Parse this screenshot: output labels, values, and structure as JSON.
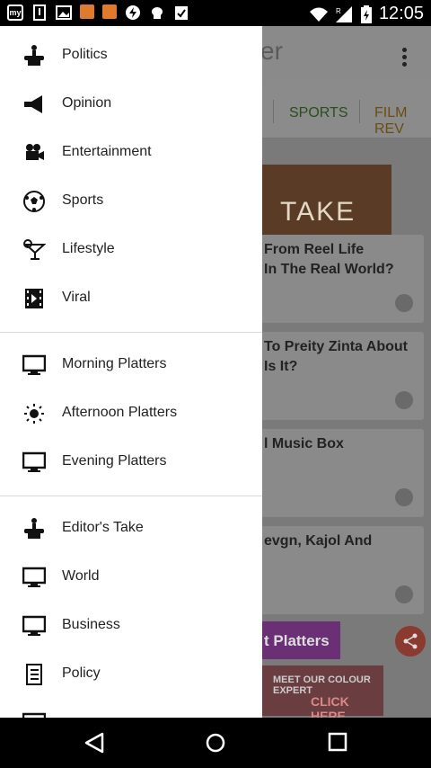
{
  "status_bar": {
    "time": "12:05",
    "left_icons": [
      "my-app-icon",
      "download-icon",
      "image-icon",
      "notification-icon",
      "notification-icon",
      "flash-icon",
      "android-icon",
      "clipboard-check-icon"
    ],
    "right_icons": [
      "wifi-icon",
      "signal-icon",
      "battery-icon"
    ],
    "roaming": "R"
  },
  "background_app": {
    "tabs": [
      {
        "label": "SPORTS",
        "color": "#2b4d1e"
      },
      {
        "label": "FILM REV",
        "color": "#6b4c12"
      }
    ],
    "banner_text": "TAKE",
    "cards": [
      {
        "title": "From Reel Life\nIn The Real World?"
      },
      {
        "title": "To Preity Zinta About\nIs It?"
      },
      {
        "title": "l Music Box"
      },
      {
        "title": "evgn, Kajol And"
      }
    ],
    "platters_button": "t Platters",
    "ad": {
      "line1": "MEET OUR COLOUR EXPERT",
      "line2": "CLICK HERE"
    }
  },
  "drawer": {
    "group1": [
      {
        "label": "Politics",
        "icon": "podium-icon"
      },
      {
        "label": "Opinion",
        "icon": "megaphone-icon"
      },
      {
        "label": "Entertainment",
        "icon": "camera-icon"
      },
      {
        "label": "Sports",
        "icon": "soccer-ball-icon"
      },
      {
        "label": "Lifestyle",
        "icon": "cocktail-icon"
      },
      {
        "label": "Viral",
        "icon": "film-icon"
      }
    ],
    "group2": [
      {
        "label": "Morning Platters",
        "icon": "monitor-icon"
      },
      {
        "label": "Afternoon Platters",
        "icon": "sun-icon"
      },
      {
        "label": "Evening Platters",
        "icon": "monitor-icon"
      }
    ],
    "group3": [
      {
        "label": "Editor's Take",
        "icon": "podium-icon"
      },
      {
        "label": "World",
        "icon": "monitor-icon"
      },
      {
        "label": "Business",
        "icon": "monitor-icon"
      },
      {
        "label": "Policy",
        "icon": "list-icon"
      }
    ]
  },
  "navbar": {
    "back": "back-icon",
    "home": "home-icon",
    "recents": "recents-icon"
  }
}
